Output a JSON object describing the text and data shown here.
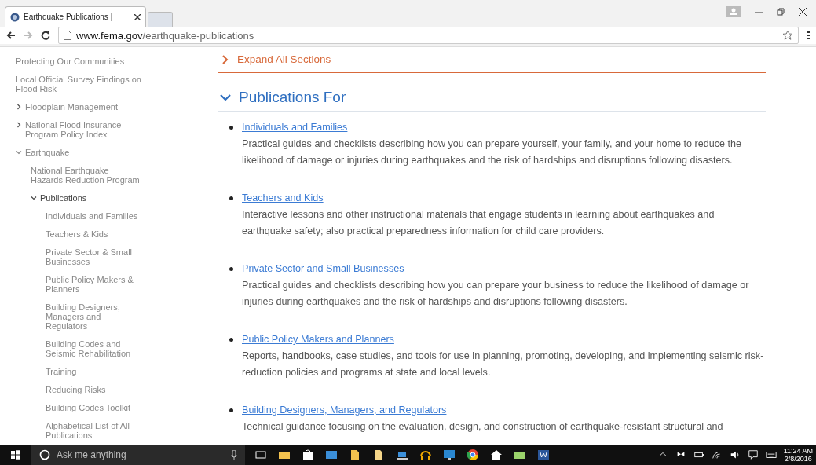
{
  "browser": {
    "tab_title": "Earthquake Publications |",
    "url_host": "www.fema.gov",
    "url_path": "/earthquake-publications"
  },
  "sidebar": {
    "items": [
      {
        "label": "Protecting Our Communities",
        "kind": "link",
        "selected": false
      },
      {
        "label": "Local Official Survey Findings on Flood Risk",
        "kind": "link",
        "selected": false
      },
      {
        "label": "Floodplain Management",
        "kind": "folder",
        "expanded": false,
        "selected": false
      },
      {
        "label": "National Flood Insurance Program Policy Index",
        "kind": "folder",
        "expanded": false,
        "selected": false
      },
      {
        "label": "Earthquake",
        "kind": "folder",
        "expanded": true,
        "selected": false,
        "children": [
          {
            "label": "National Earthquake Hazards Reduction Program",
            "kind": "link",
            "selected": false
          },
          {
            "label": "Publications",
            "kind": "folder",
            "expanded": true,
            "selected": true,
            "children": [
              {
                "label": "Individuals and Families",
                "kind": "link",
                "selected": false
              },
              {
                "label": "Teachers & Kids",
                "kind": "link",
                "selected": false
              },
              {
                "label": "Private Sector & Small Businesses",
                "kind": "link",
                "selected": false
              },
              {
                "label": "Public Policy Makers & Planners",
                "kind": "link",
                "selected": false
              },
              {
                "label": "Building Designers, Managers and Regulators",
                "kind": "link",
                "selected": false
              },
              {
                "label": "Building Codes and Seismic Rehabilitation",
                "kind": "link",
                "selected": false
              },
              {
                "label": "Training",
                "kind": "link",
                "selected": false
              },
              {
                "label": "Reducing Risks",
                "kind": "link",
                "selected": false
              },
              {
                "label": "Building Codes Toolkit",
                "kind": "link",
                "selected": false
              },
              {
                "label": "Alphabetical List of All Publications",
                "kind": "link",
                "selected": false
              }
            ]
          }
        ]
      }
    ]
  },
  "main": {
    "expand_all": "Expand All Sections",
    "section": {
      "title": "Publications For",
      "expanded": true,
      "items": [
        {
          "link": "Individuals and Families",
          "description": "Practical guides and checklists describing how you can prepare yourself, your family, and your home to reduce the likelihood of damage or injuries during earthquakes and the risk of hardships and disruptions following disasters."
        },
        {
          "link": "Teachers and Kids",
          "description": "Interactive lessons and other instructional materials that engage students in learning about earthquakes and earthquake safety; also practical preparedness information for child care providers."
        },
        {
          "link": "Private Sector and Small Businesses",
          "description": "Practical guides and checklists describing how you can prepare your business to reduce the likelihood of damage or injuries during earthquakes and the risk of hardships and disruptions following disasters."
        },
        {
          "link": "Public Policy Makers and Planners",
          "description": "Reports, handbooks, case studies, and tools for use in planning, promoting, developing, and implementing seismic risk-reduction policies and programs at state and local levels."
        },
        {
          "link": "Building Designers, Managers, and Regulators",
          "description": "Technical guidance focusing on the evaluation, design, and construction of earthquake-resistant structural and"
        }
      ]
    }
  },
  "taskbar": {
    "search_placeholder": "Ask me anything",
    "time": "11:24 AM",
    "date": "2/8/2016"
  }
}
